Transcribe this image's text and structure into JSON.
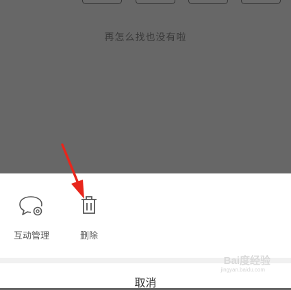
{
  "background": {
    "empty_message": "再怎么找也没有啦"
  },
  "action_sheet": {
    "actions": [
      {
        "label": "互动管理",
        "icon": "comment-settings-icon"
      },
      {
        "label": "删除",
        "icon": "trash-icon"
      }
    ],
    "cancel_label": "取消"
  },
  "watermark": {
    "text": "Bai度经验",
    "sub": "jingyan.baidu.com"
  },
  "annotation": {
    "arrow_color": "#e8261c"
  }
}
